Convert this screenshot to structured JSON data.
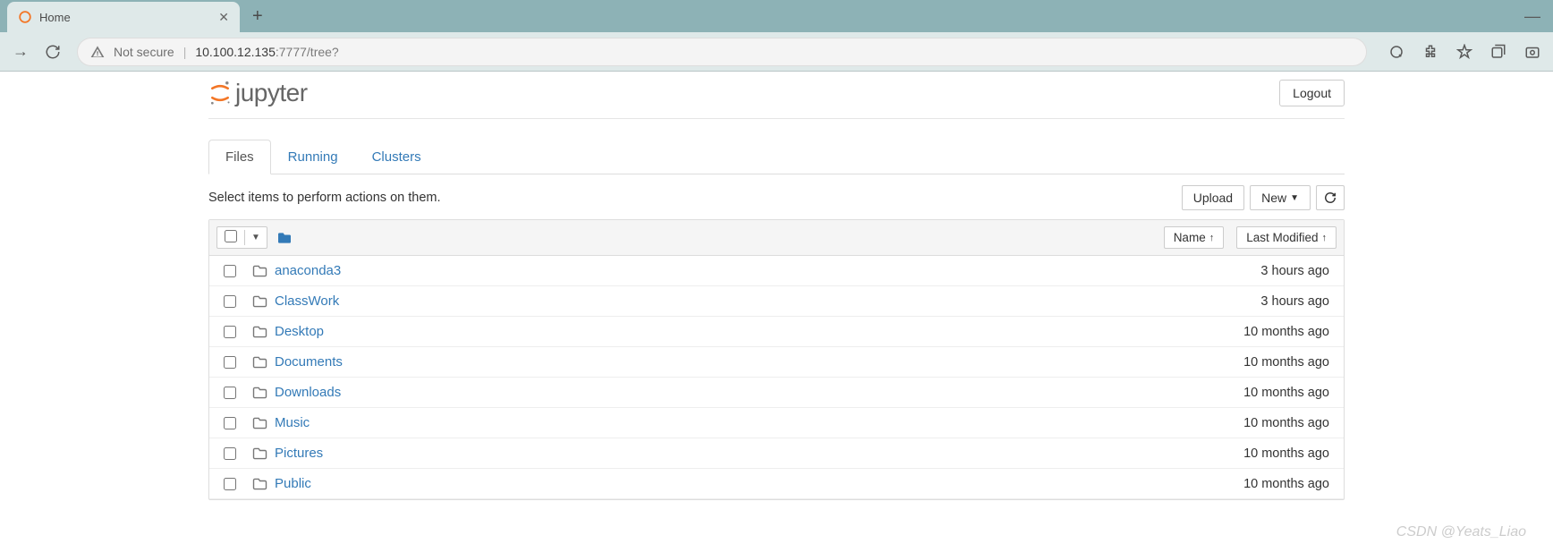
{
  "browser": {
    "tab_title": "Home",
    "not_secure_label": "Not secure",
    "url_host": "10.100.12.135",
    "url_port": ":7777",
    "url_path": "/tree?"
  },
  "header": {
    "logo_text": "jupyter",
    "logout_label": "Logout"
  },
  "tabs": [
    {
      "label": "Files",
      "active": true
    },
    {
      "label": "Running",
      "active": false
    },
    {
      "label": "Clusters",
      "active": false
    }
  ],
  "action_text": "Select items to perform actions on them.",
  "buttons": {
    "upload": "Upload",
    "new": "New"
  },
  "columns": {
    "name": "Name",
    "modified": "Last Modified"
  },
  "files": [
    {
      "name": "anaconda3",
      "modified": "3 hours ago"
    },
    {
      "name": "ClassWork",
      "modified": "3 hours ago"
    },
    {
      "name": "Desktop",
      "modified": "10 months ago"
    },
    {
      "name": "Documents",
      "modified": "10 months ago"
    },
    {
      "name": "Downloads",
      "modified": "10 months ago"
    },
    {
      "name": "Music",
      "modified": "10 months ago"
    },
    {
      "name": "Pictures",
      "modified": "10 months ago"
    },
    {
      "name": "Public",
      "modified": "10 months ago"
    }
  ],
  "watermark": "CSDN @Yeats_Liao"
}
